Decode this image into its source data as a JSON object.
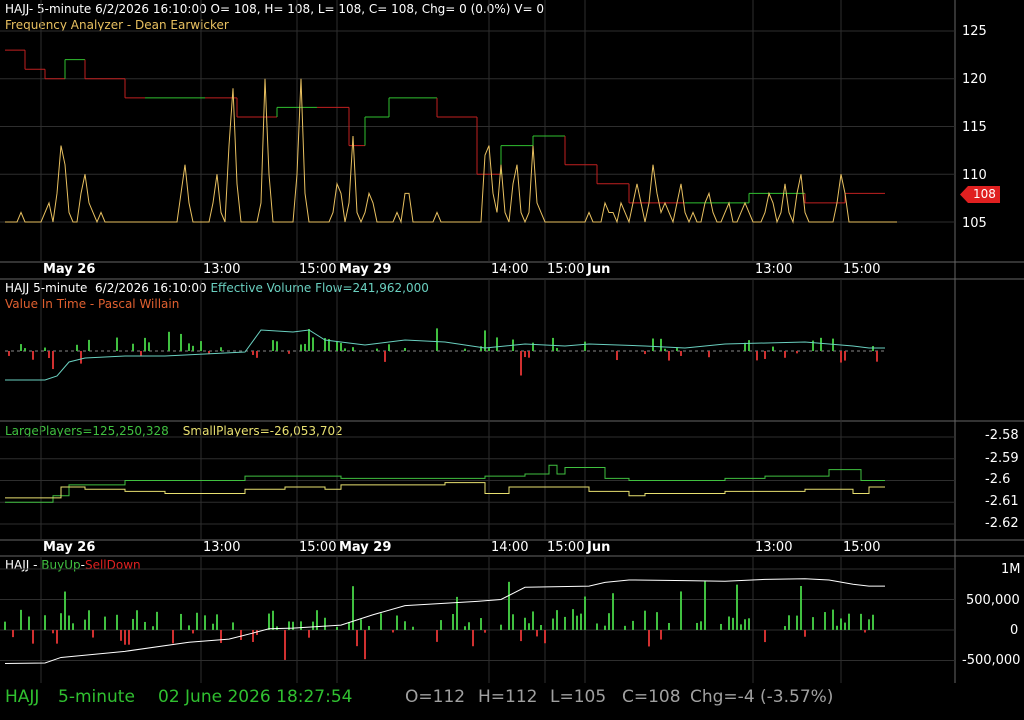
{
  "colors": {
    "background": "#000000",
    "grid": "#2e2e2e",
    "axis": "#666666",
    "freq_line": "#e8c060",
    "price_up": "#30c030",
    "price_down": "#c02020",
    "evf_line": "#6ad0c0",
    "vit_up": "#40c040",
    "vit_down": "#d03030",
    "large_players": "#40c040",
    "small_players": "#e8e070",
    "buyup": "#40c040",
    "selldown": "#d03030",
    "cum_line": "#ffffff",
    "tag": "#e02020",
    "status_green": "#30c030",
    "status_grey": "#a0a0a0"
  },
  "panel1": {
    "header_line1": "HAJJ- 5-minute 6/2/2026 16:10:00 O= 108, H= 108, L= 108, C= 108, Chg= 0 (0.0%) V= 0",
    "header_line2": "Frequency Analyzer - Dean Earwicker",
    "y_ticks": [
      "125",
      "120",
      "115",
      "110",
      "105"
    ],
    "last_price_tag": "108"
  },
  "x_axis": {
    "labels": [
      {
        "text": "May 26",
        "bold": true,
        "x_index": 10
      },
      {
        "text": "13:00",
        "bold": false,
        "x_index": 50
      },
      {
        "text": "15:00",
        "bold": false,
        "x_index": 74
      },
      {
        "text": "May 29",
        "bold": true,
        "x_index": 84
      },
      {
        "text": "14:00",
        "bold": false,
        "x_index": 122
      },
      {
        "text": "15:00",
        "bold": false,
        "x_index": 136
      },
      {
        "text": "Jun",
        "bold": true,
        "x_index": 146
      },
      {
        "text": "13:00",
        "bold": false,
        "x_index": 188
      },
      {
        "text": "15:00",
        "bold": false,
        "x_index": 210
      }
    ]
  },
  "panel2": {
    "header_prefix": "HAJJ 5-minute  6/2/2026 16:10:00 ",
    "header_indicator": "Effective Volume Flow=241,962,000",
    "subtitle": "Value In Time - Pascal Willain"
  },
  "panel3": {
    "large_players": "LargePlayers=125,250,328",
    "small_players": "SmallPlayers=-26,053,702",
    "y_ticks": [
      "-2.58",
      "-2.59",
      "-2.6",
      "-2.61",
      "-2.62"
    ]
  },
  "panel4": {
    "header_prefix": "HAJJ - ",
    "buyup_label": "BuyUp",
    "dash": "-",
    "selldown_label": "SellDown",
    "y_ticks": [
      "1M",
      "500,000",
      "0",
      "-500,000"
    ]
  },
  "status": {
    "symbol": "HAJJ",
    "interval": "5-minute",
    "datetime": "02 June 2026 18:27:54",
    "open": "O=112",
    "high": "H=112",
    "low": "L=105",
    "close": "C=108",
    "change": "Chg=-4 (-3.57%)"
  },
  "chart_data": [
    {
      "type": "line",
      "title": "Frequency Analyzer - Dean Earwicker",
      "ylim": [
        102,
        127
      ],
      "y_ticks": [
        125,
        120,
        115,
        110,
        105
      ],
      "last_value": 108,
      "x_count": 220,
      "series": [
        {
          "name": "HAJJ",
          "style": "step",
          "segments": [
            {
              "i0": 0,
              "i1": 5,
              "v": 123,
              "dir": "down"
            },
            {
              "i0": 5,
              "i1": 10,
              "v": 121,
              "dir": "down"
            },
            {
              "i0": 10,
              "i1": 15,
              "v": 120,
              "dir": "down"
            },
            {
              "i0": 15,
              "i1": 20,
              "v": 122,
              "dir": "up"
            },
            {
              "i0": 20,
              "i1": 30,
              "v": 120,
              "dir": "down"
            },
            {
              "i0": 30,
              "i1": 35,
              "v": 118,
              "dir": "down"
            },
            {
              "i0": 35,
              "i1": 50,
              "v": 118,
              "dir": "up"
            },
            {
              "i0": 50,
              "i1": 58,
              "v": 118,
              "dir": "down"
            },
            {
              "i0": 58,
              "i1": 68,
              "v": 116,
              "dir": "down"
            },
            {
              "i0": 68,
              "i1": 78,
              "v": 117,
              "dir": "up"
            },
            {
              "i0": 78,
              "i1": 86,
              "v": 117,
              "dir": "down"
            },
            {
              "i0": 86,
              "i1": 90,
              "v": 113,
              "dir": "down"
            },
            {
              "i0": 90,
              "i1": 96,
              "v": 116,
              "dir": "up"
            },
            {
              "i0": 96,
              "i1": 108,
              "v": 118,
              "dir": "up"
            },
            {
              "i0": 108,
              "i1": 118,
              "v": 116,
              "dir": "down"
            },
            {
              "i0": 118,
              "i1": 124,
              "v": 110,
              "dir": "down"
            },
            {
              "i0": 124,
              "i1": 132,
              "v": 113,
              "dir": "up"
            },
            {
              "i0": 132,
              "i1": 140,
              "v": 114,
              "dir": "up"
            },
            {
              "i0": 140,
              "i1": 148,
              "v": 111,
              "dir": "down"
            },
            {
              "i0": 148,
              "i1": 156,
              "v": 109,
              "dir": "down"
            },
            {
              "i0": 156,
              "i1": 170,
              "v": 107,
              "dir": "down"
            },
            {
              "i0": 170,
              "i1": 186,
              "v": 107,
              "dir": "up"
            },
            {
              "i0": 186,
              "i1": 200,
              "v": 108,
              "dir": "up"
            },
            {
              "i0": 200,
              "i1": 210,
              "v": 107,
              "dir": "down"
            },
            {
              "i0": 210,
              "i1": 220,
              "v": 108,
              "dir": "down"
            }
          ]
        },
        {
          "name": "Frequency",
          "style": "line",
          "values": [
            105,
            105,
            105,
            105,
            106,
            105,
            105,
            105,
            105,
            105,
            106,
            107,
            105,
            108,
            113,
            111,
            106,
            105,
            105,
            108,
            110,
            107,
            106,
            105,
            106,
            105,
            105,
            105,
            105,
            105,
            105,
            105,
            105,
            105,
            105,
            105,
            105,
            105,
            105,
            105,
            105,
            105,
            105,
            105,
            108,
            111,
            107,
            105,
            105,
            105,
            105,
            105,
            107,
            110,
            106,
            105,
            113,
            119,
            109,
            105,
            105,
            105,
            105,
            105,
            107,
            120,
            110,
            105,
            105,
            105,
            105,
            105,
            105,
            110,
            120,
            108,
            105,
            105,
            105,
            105,
            105,
            105,
            106,
            109,
            108,
            105,
            107,
            114,
            106,
            105,
            106,
            108,
            107,
            105,
            105,
            105,
            105,
            105,
            106,
            105,
            108,
            108,
            105,
            105,
            105,
            105,
            105,
            105,
            106,
            105,
            105,
            105,
            105,
            105,
            105,
            105,
            105,
            105,
            105,
            105,
            112,
            113,
            108,
            106,
            111,
            106,
            105,
            109,
            111,
            106,
            105,
            106,
            113,
            107,
            106,
            105,
            105,
            105,
            105,
            105,
            105,
            105,
            105,
            105,
            105,
            105,
            106,
            105,
            105,
            105,
            107,
            106,
            106,
            105,
            107,
            106,
            105,
            107,
            109,
            107,
            105,
            107,
            111,
            108,
            106,
            107,
            106,
            105,
            107,
            109,
            106,
            105,
            106,
            105,
            105,
            107,
            108,
            106,
            105,
            105,
            106,
            107,
            105,
            105,
            106,
            107,
            106,
            105,
            105,
            105,
            106,
            108,
            107,
            105,
            106,
            109,
            106,
            105,
            108,
            110,
            106,
            105,
            105,
            105,
            105,
            105,
            105,
            105,
            107,
            110,
            108,
            105,
            105,
            105,
            105,
            105,
            105,
            105,
            105,
            105,
            105,
            105,
            105,
            105
          ]
        }
      ]
    },
    {
      "type": "line",
      "title": "Value In Time - Pascal Willain",
      "ylim": [
        -1,
        1
      ],
      "series": [
        {
          "name": "Effective Volume Flow",
          "style": "line",
          "values_key": "evf"
        },
        {
          "name": "Value In Time",
          "style": "bar",
          "values_key": "vit"
        }
      ]
    },
    {
      "type": "line",
      "ylim": [
        -2.625,
        -2.575
      ],
      "y_ticks": [
        -2.58,
        -2.59,
        -2.6,
        -2.61,
        -2.62
      ],
      "series": [
        {
          "name": "LargePlayers",
          "style": "step",
          "points": [
            [
              0,
              -2.61
            ],
            [
              8,
              -2.61
            ],
            [
              12,
              -2.607
            ],
            [
              16,
              -2.602
            ],
            [
              18,
              -2.602
            ],
            [
              30,
              -2.6
            ],
            [
              32,
              -2.6
            ],
            [
              46,
              -2.6
            ],
            [
              60,
              -2.598
            ],
            [
              80,
              -2.598
            ],
            [
              84,
              -2.599
            ],
            [
              100,
              -2.599
            ],
            [
              110,
              -2.599
            ],
            [
              120,
              -2.598
            ],
            [
              130,
              -2.597
            ],
            [
              136,
              -2.593
            ],
            [
              138,
              -2.597
            ],
            [
              140,
              -2.594
            ],
            [
              146,
              -2.594
            ],
            [
              150,
              -2.599
            ],
            [
              156,
              -2.6
            ],
            [
              160,
              -2.6
            ],
            [
              170,
              -2.6
            ],
            [
              180,
              -2.599
            ],
            [
              190,
              -2.598
            ],
            [
              200,
              -2.598
            ],
            [
              206,
              -2.595
            ],
            [
              212,
              -2.595
            ],
            [
              214,
              -2.6
            ],
            [
              220,
              -2.6
            ]
          ]
        },
        {
          "name": "SmallPlayers",
          "style": "step",
          "points": [
            [
              0,
              -2.608
            ],
            [
              10,
              -2.608
            ],
            [
              14,
              -2.603
            ],
            [
              20,
              -2.604
            ],
            [
              30,
              -2.605
            ],
            [
              40,
              -2.606
            ],
            [
              50,
              -2.606
            ],
            [
              60,
              -2.604
            ],
            [
              70,
              -2.603
            ],
            [
              80,
              -2.604
            ],
            [
              84,
              -2.602
            ],
            [
              100,
              -2.602
            ],
            [
              110,
              -2.601
            ],
            [
              120,
              -2.606
            ],
            [
              126,
              -2.603
            ],
            [
              140,
              -2.603
            ],
            [
              146,
              -2.605
            ],
            [
              150,
              -2.605
            ],
            [
              156,
              -2.607
            ],
            [
              160,
              -2.606
            ],
            [
              170,
              -2.606
            ],
            [
              180,
              -2.605
            ],
            [
              190,
              -2.605
            ],
            [
              200,
              -2.604
            ],
            [
              206,
              -2.604
            ],
            [
              212,
              -2.606
            ],
            [
              216,
              -2.603
            ],
            [
              220,
              -2.603
            ]
          ]
        }
      ]
    },
    {
      "type": "bar",
      "title": "HAJJ - BuyUp-SellDown",
      "ylim": [
        -650000,
        1150000
      ],
      "y_ticks": [
        1000000,
        500000,
        0,
        -500000
      ],
      "series": [
        {
          "name": "BuyUp",
          "style": "bar"
        },
        {
          "name": "SellDown",
          "style": "bar"
        },
        {
          "name": "Cumulative",
          "style": "line",
          "points": [
            [
              0,
              -550000
            ],
            [
              10,
              -540000
            ],
            [
              14,
              -450000
            ],
            [
              30,
              -350000
            ],
            [
              46,
              -200000
            ],
            [
              56,
              -150000
            ],
            [
              62,
              -50000
            ],
            [
              66,
              20000
            ],
            [
              72,
              30000
            ],
            [
              84,
              80000
            ],
            [
              92,
              250000
            ],
            [
              100,
              400000
            ],
            [
              118,
              470000
            ],
            [
              124,
              500000
            ],
            [
              130,
              700000
            ],
            [
              146,
              720000
            ],
            [
              150,
              780000
            ],
            [
              156,
              820000
            ],
            [
              170,
              810000
            ],
            [
              180,
              800000
            ],
            [
              190,
              830000
            ],
            [
              200,
              840000
            ],
            [
              206,
              820000
            ],
            [
              212,
              750000
            ],
            [
              216,
              720000
            ],
            [
              220,
              720000
            ]
          ]
        }
      ]
    }
  ]
}
